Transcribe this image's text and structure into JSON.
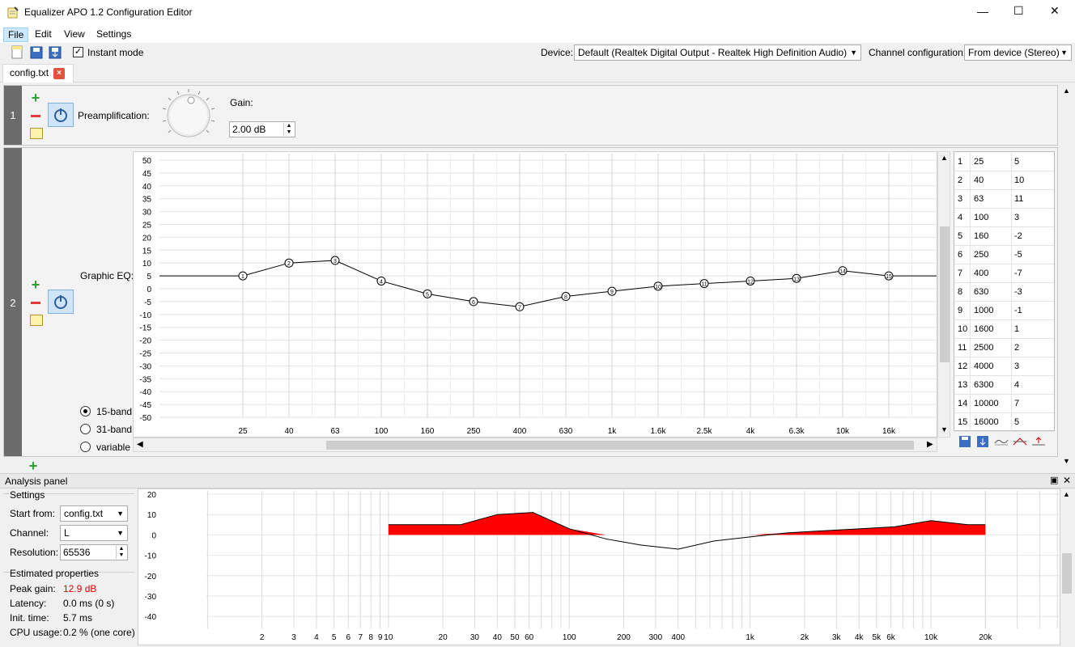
{
  "window": {
    "title": "Equalizer APO 1.2 Configuration Editor",
    "minimize": "—",
    "maximize": "☐",
    "close": "✕"
  },
  "menu": {
    "items": [
      "File",
      "Edit",
      "View",
      "Settings"
    ]
  },
  "toolbar": {
    "instant_mode": "Instant mode",
    "device_label": "Device:",
    "device_value": "Default (Realtek Digital Output - Realtek High Definition Audio)",
    "channel_label": "Channel configuration:",
    "channel_value": "From device (Stereo)"
  },
  "tabs": [
    {
      "label": "config.txt"
    }
  ],
  "preamp": {
    "row_number": "1",
    "label": "Preamplification:",
    "gain_label": "Gain:",
    "gain_value": "2.00 dB"
  },
  "graphic_eq": {
    "row_number": "2",
    "label": "Graphic EQ:",
    "band_options": [
      "15-band",
      "31-band",
      "variable"
    ],
    "selected_band": "15-band",
    "y_ticks": [
      "50",
      "45",
      "40",
      "35",
      "30",
      "25",
      "20",
      "15",
      "10",
      "5",
      "0",
      "-5",
      "-10",
      "-15",
      "-20",
      "-25",
      "-30",
      "-35",
      "-40",
      "-45",
      "-50"
    ],
    "x_ticks": [
      "25",
      "40",
      "63",
      "100",
      "160",
      "250",
      "400",
      "630",
      "1k",
      "1.6k",
      "2.5k",
      "4k",
      "6.3k",
      "10k",
      "16k"
    ],
    "bands": [
      {
        "n": "1",
        "freq": "25",
        "gain": "5"
      },
      {
        "n": "2",
        "freq": "40",
        "gain": "10"
      },
      {
        "n": "3",
        "freq": "63",
        "gain": "11"
      },
      {
        "n": "4",
        "freq": "100",
        "gain": "3"
      },
      {
        "n": "5",
        "freq": "160",
        "gain": "-2"
      },
      {
        "n": "6",
        "freq": "250",
        "gain": "-5"
      },
      {
        "n": "7",
        "freq": "400",
        "gain": "-7"
      },
      {
        "n": "8",
        "freq": "630",
        "gain": "-3"
      },
      {
        "n": "9",
        "freq": "1000",
        "gain": "-1"
      },
      {
        "n": "10",
        "freq": "1600",
        "gain": "1"
      },
      {
        "n": "11",
        "freq": "2500",
        "gain": "2"
      },
      {
        "n": "12",
        "freq": "4000",
        "gain": "3"
      },
      {
        "n": "13",
        "freq": "6300",
        "gain": "4"
      },
      {
        "n": "14",
        "freq": "10000",
        "gain": "7"
      },
      {
        "n": "15",
        "freq": "16000",
        "gain": "5"
      }
    ]
  },
  "analysis": {
    "title": "Analysis panel",
    "settings_label": "Settings",
    "start_from_label": "Start from:",
    "start_from_value": "config.txt",
    "channel_label": "Channel:",
    "channel_value": "L",
    "resolution_label": "Resolution:",
    "resolution_value": "65536",
    "estimated_label": "Estimated properties",
    "peak_gain_label": "Peak gain:",
    "peak_gain_value": "12.9 dB",
    "latency_label": "Latency:",
    "latency_value": "0.0 ms (0 s)",
    "init_time_label": "Init. time:",
    "init_time_value": "5.7 ms",
    "cpu_label": "CPU usage:",
    "cpu_value": "0.2 % (one core)",
    "y_ticks": [
      "20",
      "10",
      "0",
      "-10",
      "-20",
      "-30",
      "-40"
    ],
    "x_ticks": [
      "2",
      "3",
      "4",
      "5",
      "6",
      "7",
      "8",
      "9",
      "10",
      "20",
      "30",
      "40",
      "50",
      "60",
      "100",
      "200",
      "300",
      "400",
      "1k",
      "2k",
      "3k",
      "4k",
      "5k",
      "6k",
      "10k",
      "20k"
    ],
    "peak_color": "#ff0000"
  },
  "colors": {
    "fill": "#ff0000",
    "row_num_bg": "#6b6b6b",
    "power_bg": "#cfe4f7"
  }
}
